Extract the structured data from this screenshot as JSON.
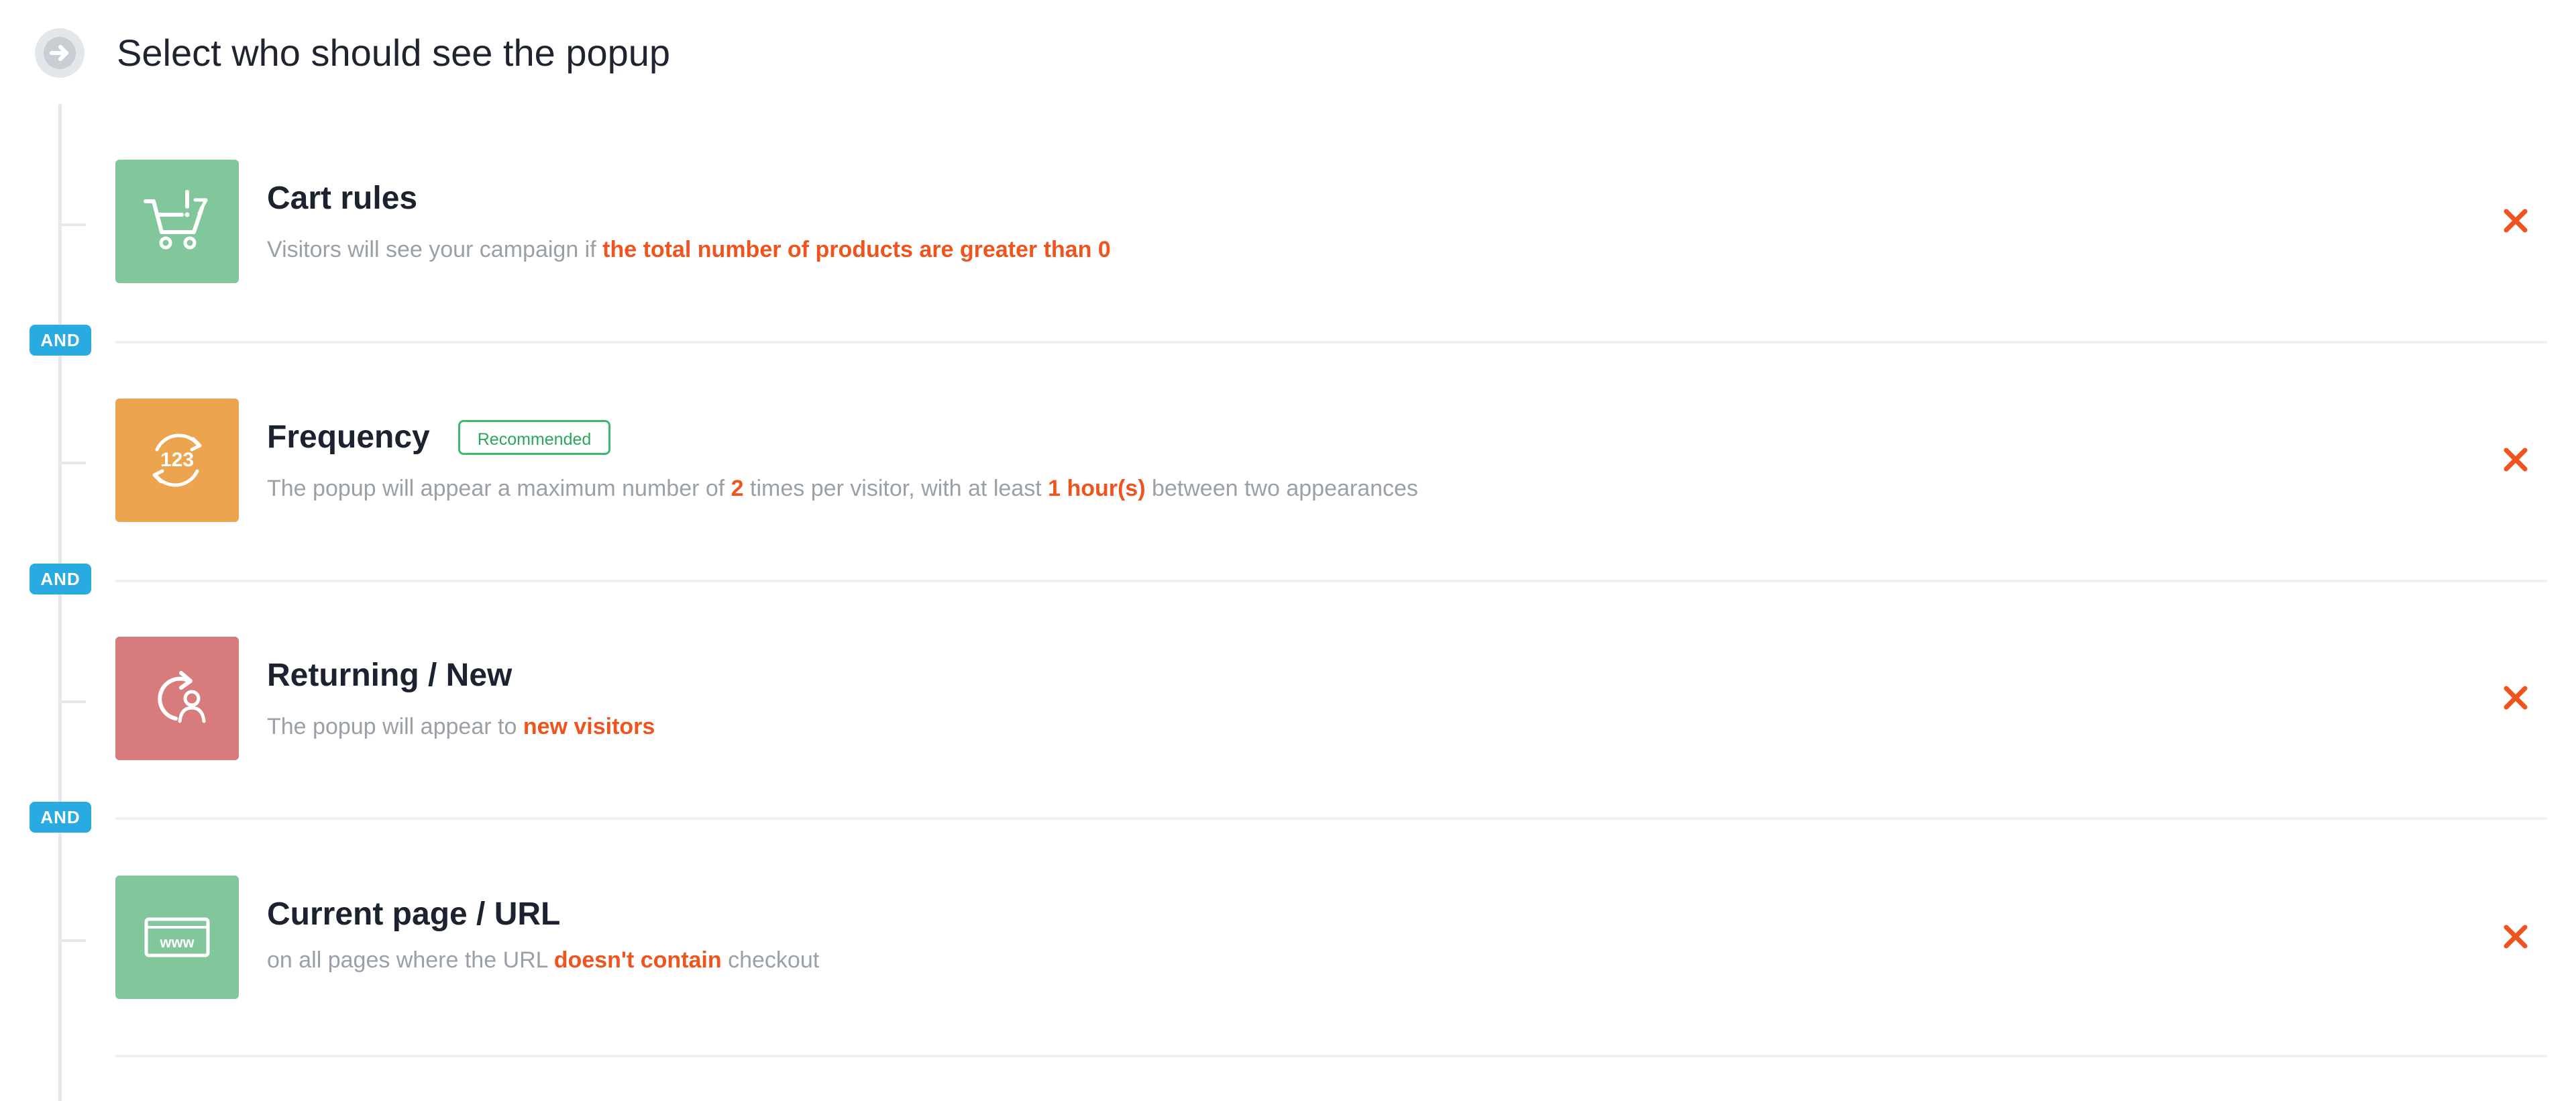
{
  "header": {
    "title": "Select who should see the popup",
    "icon": "arrow-right-circle-icon"
  },
  "connector_label": "AND",
  "rules": [
    {
      "title": "Cart rules",
      "icon": "cart-alert-icon",
      "color": "#81c79b",
      "desc_parts": [
        "Visitors will see your campaign if ",
        "the total number of products are greater than 0"
      ],
      "highlight_color": "#f0541e"
    },
    {
      "title": "Frequency",
      "badge": "Recommended",
      "icon": "frequency-123-icon",
      "color": "#eca44f",
      "desc_parts": [
        "The popup will appear a maximum number of ",
        "2",
        " times per visitor, with at least ",
        "1 hour(s)",
        " between two appearances"
      ]
    },
    {
      "title": "Returning / New",
      "icon": "returning-visitor-icon",
      "color": "#d87b7d",
      "desc_parts": [
        "The popup will appear to ",
        "new visitors"
      ]
    },
    {
      "title": "Current page / URL",
      "icon": "www-url-icon",
      "color": "#81c79b",
      "desc_parts": [
        "on all pages where the URL ",
        "doesn't contain",
        " checkout"
      ]
    }
  ],
  "remove_icon": "close-x-icon",
  "colors": {
    "accent_highlight": "#f0541e",
    "and_badge": "#29abe2",
    "recommended": "#3dbb6a",
    "remove": "#f0541e"
  }
}
